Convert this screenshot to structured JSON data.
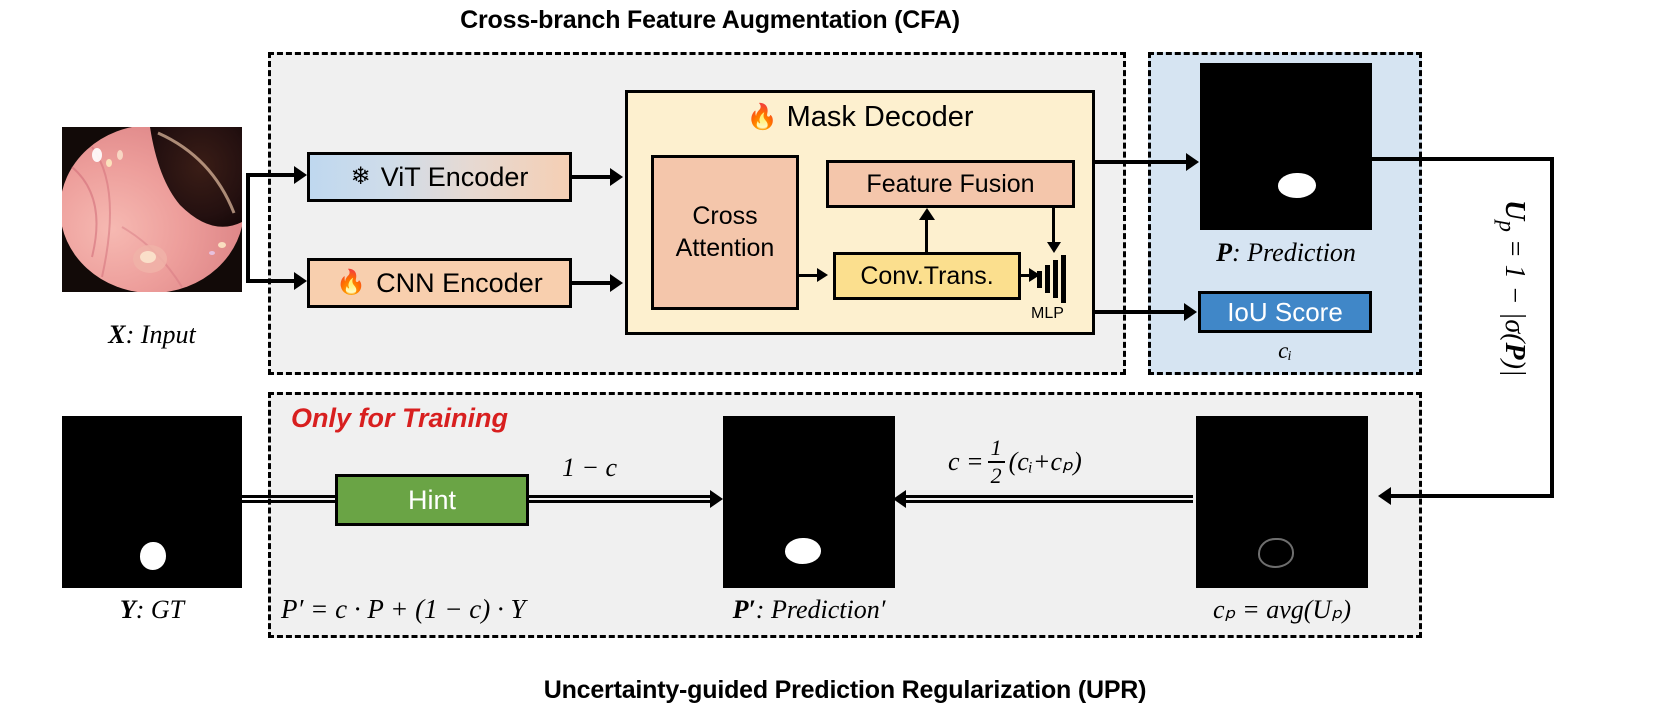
{
  "titles": {
    "cfa": "Cross-branch Feature Augmentation (CFA)",
    "upr": "Uncertainty-guided Prediction Regularization (UPR)"
  },
  "cfa": {
    "vit_encoder": "ViT Encoder",
    "vit_icon": "snowflake-icon",
    "vit_icon_glyph": "❄",
    "cnn_encoder": "CNN Encoder",
    "cnn_icon": "fire-icon",
    "cnn_icon_glyph": "🔥",
    "mask_decoder": "Mask Decoder",
    "mask_decoder_icon_glyph": "🔥",
    "cross_attention_line1": "Cross",
    "cross_attention_line2": "Attention",
    "feature_fusion": "Feature Fusion",
    "conv_trans": "Conv.Trans.",
    "mlp_label": "MLP"
  },
  "iou_panel": {
    "prediction_caption_bold": "P",
    "prediction_caption_rest": ": Prediction",
    "iou_score": "IoU Score",
    "iou_sub": "cᵢ"
  },
  "uncertainty": {
    "equation": "Uₚ = 1 − |σ(P)|",
    "eq_var": "U",
    "eq_sub": "p",
    "eq_body": " = 1 − |σ(",
    "eq_var2": "P",
    "eq_tail": ")|"
  },
  "upr": {
    "only_for_training": "Only for Training",
    "hint": "Hint",
    "one_minus_c": "1 − c",
    "c_equation_lead": "c =",
    "c_frac_num": "1",
    "c_frac_den": "2",
    "c_equation_tail": "(cᵢ+cₚ)",
    "gt_caption_bold": "Y",
    "gt_caption_rest": ": GT",
    "p_prime_formula": "P′ = c · P + (1 − c) · Y",
    "p_prime_caption_bold": "P′",
    "p_prime_caption_rest": ": Prediction′",
    "cp_caption": "cₚ = avg(Uₚ)"
  },
  "input": {
    "caption_bold": "X",
    "caption_rest": ": Input"
  },
  "colors": {
    "panel_gray": "#f0f0f0",
    "panel_blue": "#d6e4f2",
    "decoder_cream": "#fdf0cf",
    "peach": "#f4c6ab",
    "cnn_peach": "#f8cfae",
    "conv_yellow": "#fbdf8e",
    "iou_blue": "#4087c8",
    "hint_green": "#6aa445",
    "training_red": "#d81f1f",
    "vit_gradient_start": "#bfd8ef",
    "vit_gradient_end": "#f5cfb4"
  }
}
